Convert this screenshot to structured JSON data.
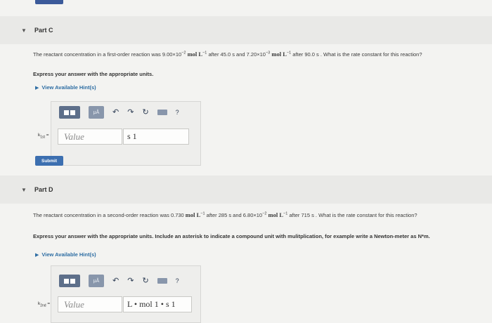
{
  "partC": {
    "header": "Part C",
    "question_pre": "The reactant concentration in a first-order reaction was 9.00×10",
    "exp1": "−2",
    "unit1": " mol L",
    "exp_inv1": "−1",
    "q_mid1": " after 45.0 s and 7.20×10",
    "exp2": "−3",
    "unit2": " mol L",
    "exp_inv2": "−1",
    "q_mid2": " after 90.0 s . What is the rate constant for this reaction?",
    "express": "Express your answer with the appropriate units.",
    "hints": "View Available Hint(s)",
    "label": "k",
    "label_sub": "1st",
    "label_eq": " =",
    "value_placeholder": "Value",
    "unit_value": "s 1",
    "submit": "Submit"
  },
  "partD": {
    "header": "Part D",
    "question_pre": "The reactant concentration in a second-order reaction was 0.730 ",
    "unit1": "mol L",
    "exp_inv1": "−1",
    "q_mid1": " after 285 s and 6.80×10",
    "exp2": "−2",
    "unit2": " mol L",
    "exp_inv2": "−1",
    "q_mid2": " after 715 s . What is the rate constant for this reaction?",
    "express": "Express your answer with the appropriate units. Include an asterisk to indicate a compound unit with mulitplication, for example write a Newton-meter as N*m.",
    "hints": "View Available Hint(s)",
    "label": "k",
    "label_sub": "2nd",
    "label_eq": " =",
    "value_placeholder": "Value",
    "unit_value": "L • mol 1 • s 1"
  },
  "toolbar": {
    "mu_label": "μÅ",
    "help_label": "?"
  },
  "icons": {
    "collapse": "chevron-down-icon",
    "hint": "triangle-right-icon",
    "undo": "undo-icon",
    "redo": "redo-icon",
    "reset": "reset-icon",
    "keyboard": "keyboard-icon"
  }
}
